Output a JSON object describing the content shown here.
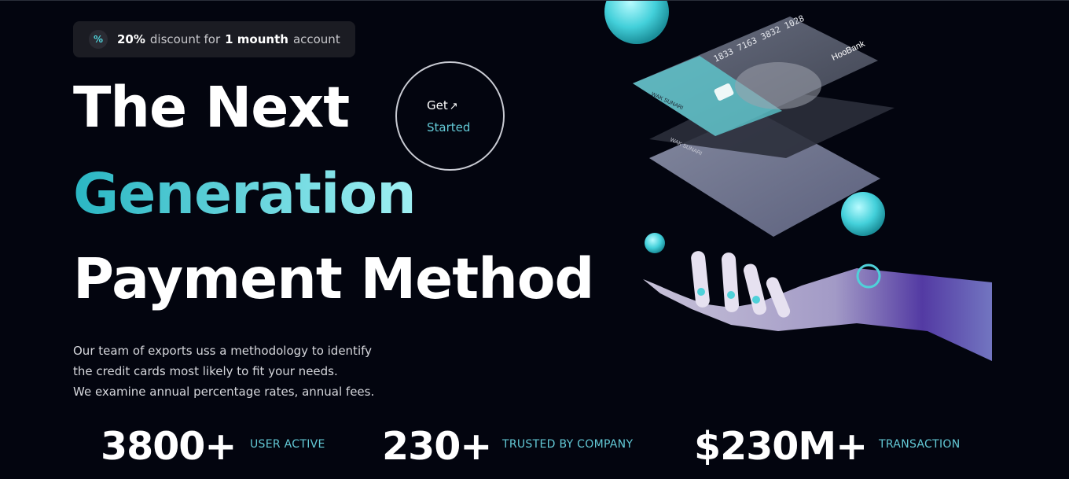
{
  "promo": {
    "icon": "percent-icon",
    "percent": "20%",
    "text_a": "discount for",
    "duration": "1 mounth",
    "text_b": "account"
  },
  "hero": {
    "line1": "The Next",
    "line2": "Generation",
    "line3": "Payment Method"
  },
  "cta": {
    "line1": "Get",
    "arrow_icon": "arrow-up-right-icon",
    "line2": "Started"
  },
  "description": {
    "line1": "Our team of exports uss a methodology to identify",
    "line2": "the credit cards most likely to fit your needs.",
    "line3": "We examine annual percentage rates, annual fees."
  },
  "stats": [
    {
      "value": "3800+",
      "label": "USER ACTIVE"
    },
    {
      "value": "230+",
      "label": "TRUSTED BY COMPANY"
    },
    {
      "value": "$230M+",
      "label": "TRANSACTION"
    }
  ],
  "illustration": {
    "card_brand": "HooBank",
    "card_number": "1833 7163 3832 1028",
    "card_holder": "WAK SUNARI",
    "card_holder_2": "WAK SUNARI"
  },
  "colors": {
    "background": "#03050f",
    "accent": "#63c9d6",
    "gradient_start": "#2ab6c3",
    "gradient_end": "#9ff0f3"
  }
}
